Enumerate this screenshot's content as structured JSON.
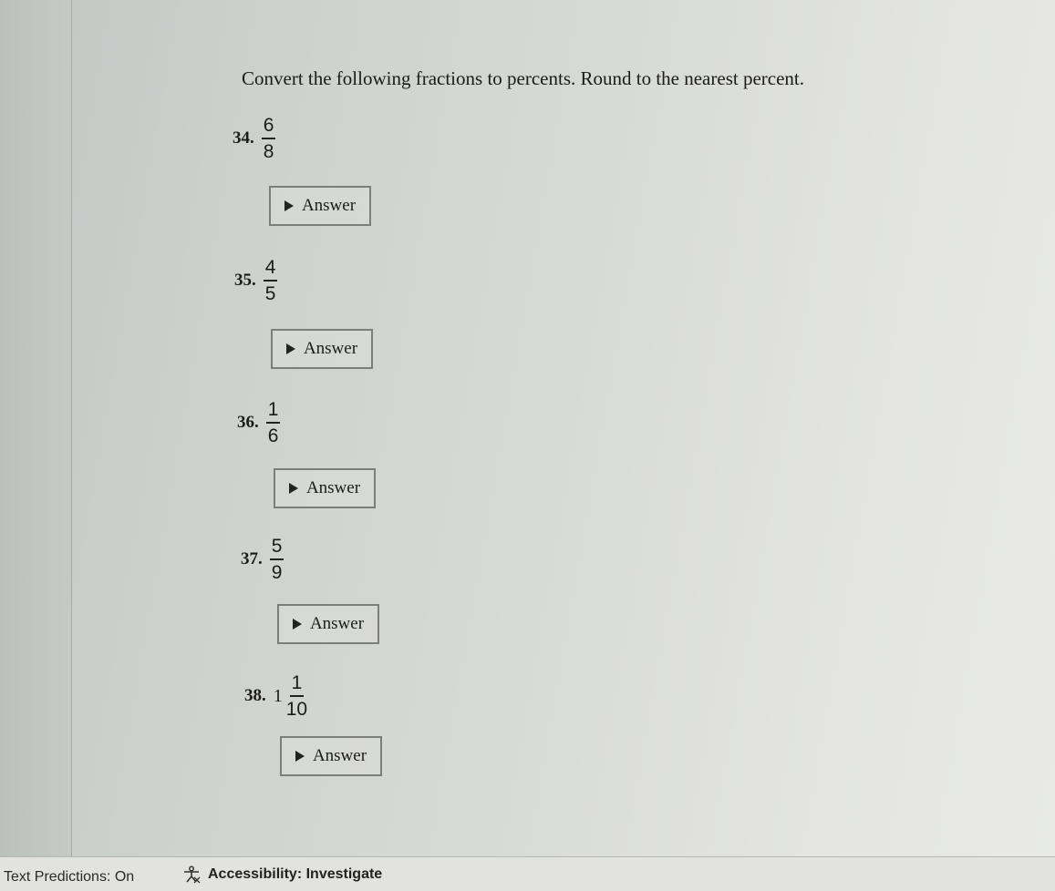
{
  "instruction": "Convert the following fractions to percents. Round to the nearest percent.",
  "problems": [
    {
      "number": "34.",
      "whole": "",
      "numerator": "6",
      "denominator": "8",
      "answer_label": "Answer"
    },
    {
      "number": "35.",
      "whole": "",
      "numerator": "4",
      "denominator": "5",
      "answer_label": "Answer"
    },
    {
      "number": "36.",
      "whole": "",
      "numerator": "1",
      "denominator": "6",
      "answer_label": "Answer"
    },
    {
      "number": "37.",
      "whole": "",
      "numerator": "5",
      "denominator": "9",
      "answer_label": "Answer"
    },
    {
      "number": "38.",
      "whole": "1",
      "numerator": "1",
      "denominator": "10",
      "answer_label": "Answer"
    }
  ],
  "status_bar": {
    "text_predictions": "Text Predictions: On",
    "accessibility": "Accessibility: Investigate",
    "accessibility_icon": "accessibility-icon"
  }
}
